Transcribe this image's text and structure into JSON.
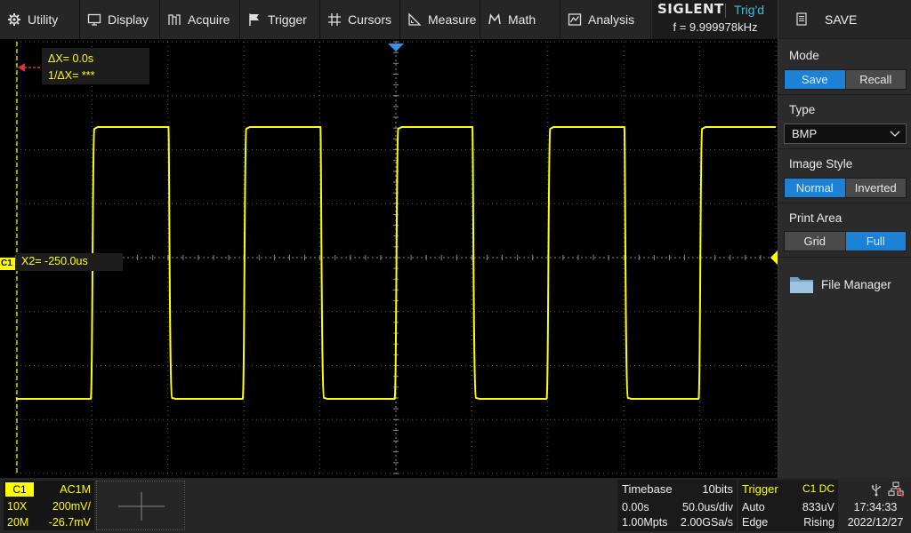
{
  "menu": [
    {
      "id": "utility",
      "label": "Utility",
      "icon": "gear-icon"
    },
    {
      "id": "display",
      "label": "Display",
      "icon": "monitor-icon"
    },
    {
      "id": "acquire",
      "label": "Acquire",
      "icon": "acquire-icon"
    },
    {
      "id": "trigger",
      "label": "Trigger",
      "icon": "flag-icon"
    },
    {
      "id": "cursors",
      "label": "Cursors",
      "icon": "crosshair-icon"
    },
    {
      "id": "measure",
      "label": "Measure",
      "icon": "ruler-icon"
    },
    {
      "id": "math",
      "label": "Math",
      "icon": "math-icon"
    },
    {
      "id": "analysis",
      "label": "Analysis",
      "icon": "analysis-icon"
    }
  ],
  "brand": {
    "logo": "SIGLENT",
    "trigger_status": "Trig'd",
    "frequency": "f = 9.999978kHz"
  },
  "panel": {
    "title": "SAVE",
    "mode": {
      "label": "Mode",
      "options": [
        "Save",
        "Recall"
      ],
      "selected": 0
    },
    "type": {
      "label": "Type",
      "value": "BMP"
    },
    "image_style": {
      "label": "Image Style",
      "options": [
        "Normal",
        "Inverted"
      ],
      "selected": 0
    },
    "print_area": {
      "label": "Print Area",
      "options": [
        "Grid",
        "Full"
      ],
      "selected": 1
    },
    "file_manager": "File Manager"
  },
  "waveform": {
    "cursor_dx": "ΔX= 0.0s",
    "cursor_inv_dx": "1/ΔX= ***",
    "x2": "X2= -250.0us",
    "channel_marker": "C1",
    "trace_color": "#ffff00",
    "grid_color": "#5a5a5a"
  },
  "bottom": {
    "ch1": {
      "badge": "C1",
      "coupling": "AC1M",
      "probe": "10X",
      "scale": "200mV/",
      "bandwidth": "20M",
      "offset": "-26.7mV"
    },
    "timebase": {
      "title": "Timebase",
      "bits": "10bits",
      "delay": "0.00s",
      "scale": "50.0us/div",
      "memory": "1.00Mpts",
      "sample_rate": "2.00GSa/s"
    },
    "trigger": {
      "title": "Trigger",
      "source": "C1 DC",
      "mode": "Auto",
      "level": "833uV",
      "type": "Edge",
      "slope": "Rising"
    },
    "clock": {
      "time": "17:34:33",
      "date": "2022/12/27"
    }
  }
}
